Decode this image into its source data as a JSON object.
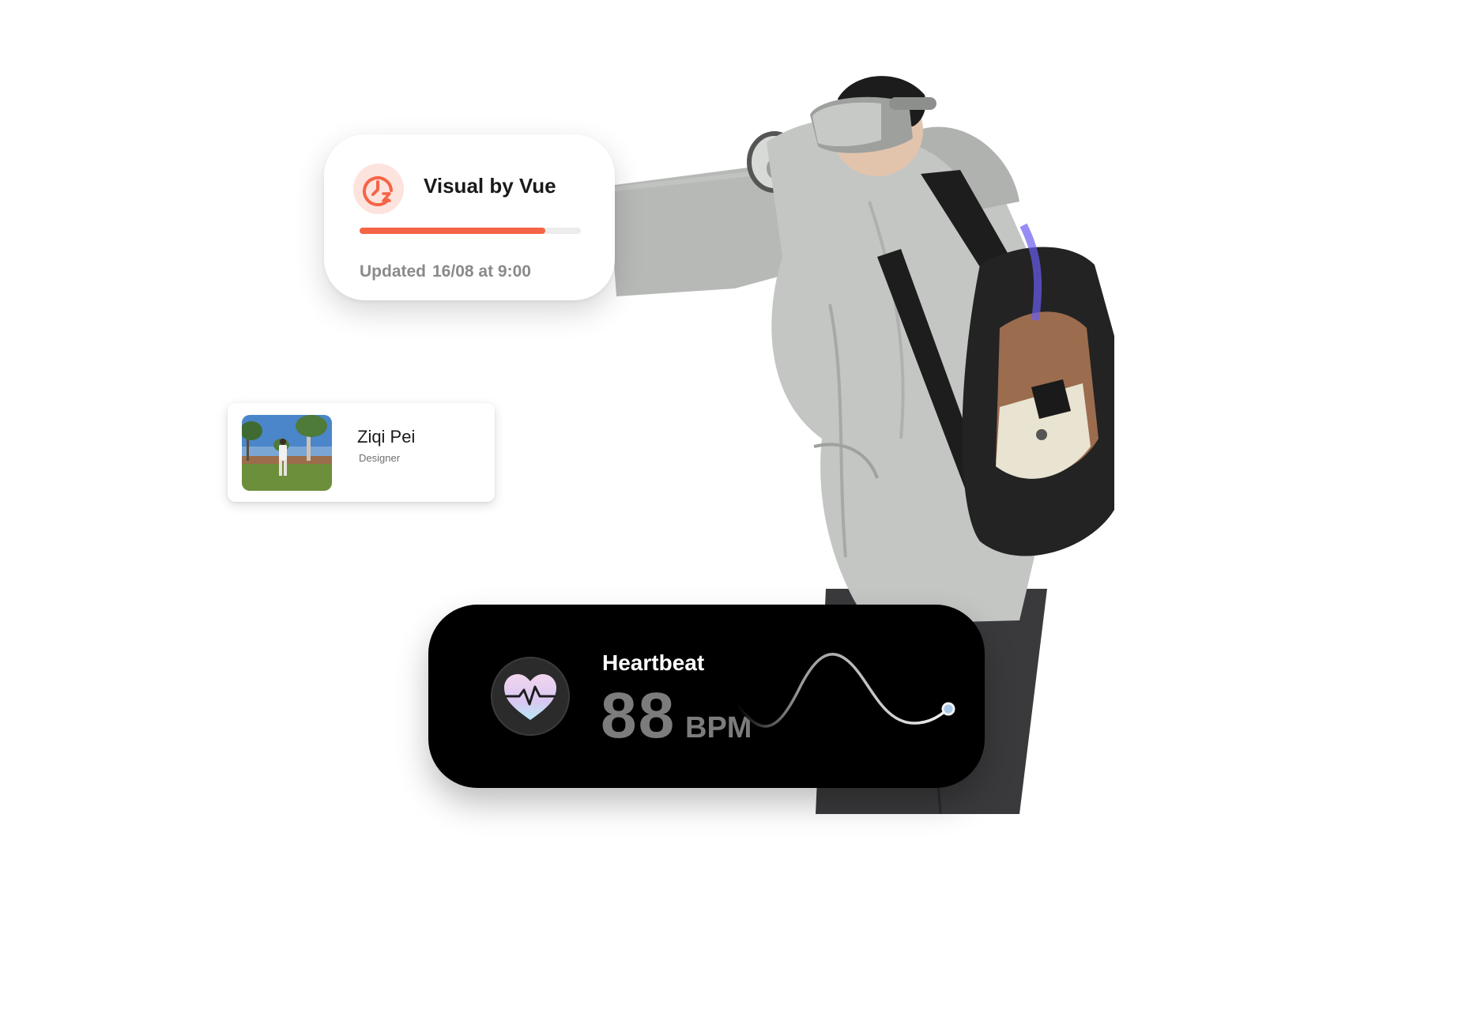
{
  "project_card": {
    "title": "Visual by Vue",
    "progress": 0.84,
    "updated_label": "Updated",
    "updated_time": "16/08 at 9:00",
    "icon": "clock-icon",
    "accent_color": "#f56446"
  },
  "profile_card": {
    "name": "Ziqi Pei",
    "role": "Designer",
    "avatar": "profile-photo"
  },
  "heartbeat": {
    "label": "Heartbeat",
    "value": "88",
    "unit": "BPM",
    "icon": "heart-pulse-icon"
  }
}
